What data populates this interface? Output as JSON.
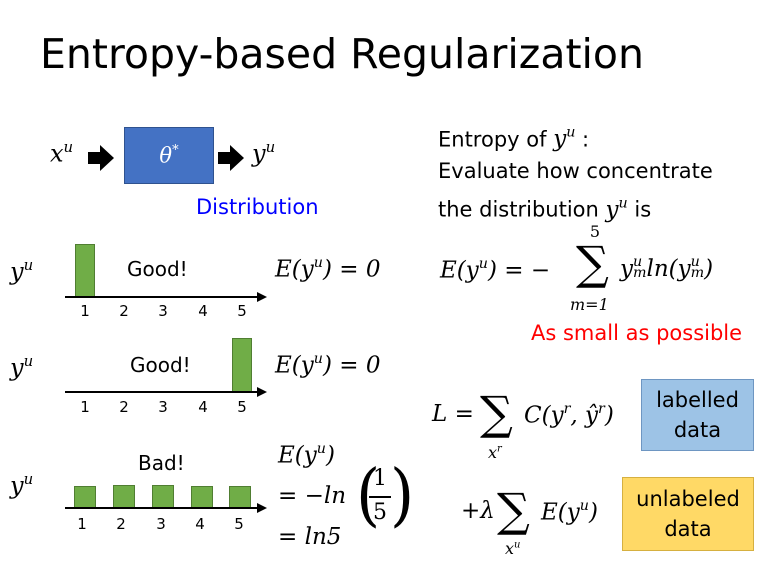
{
  "title": "Entropy-based Regularization",
  "model": {
    "input": "x",
    "input_sup": "u",
    "param": "θ",
    "param_sup": "*",
    "output": "y",
    "output_sup": "u",
    "distribution_label": "Distribution",
    "box_color": "#4472c4"
  },
  "entropy_text": {
    "line1_prefix": "Entropy of ",
    "line1_var": "y",
    "line1_sup": "u",
    "line1_suffix": " :",
    "line2": "Evaluate how concentrate",
    "line3_prefix": "the distribution ",
    "line3_var": "y",
    "line3_sup": "u",
    "line3_suffix": " is"
  },
  "examples": [
    {
      "ylabel": "y",
      "ylabel_sup": "u",
      "verdict": "Good!",
      "values": [
        1,
        0,
        0,
        0,
        0
      ],
      "formula": "E(y",
      "formula_sup": "u",
      "formula_end": ") = 0"
    },
    {
      "ylabel": "y",
      "ylabel_sup": "u",
      "verdict": "Good!",
      "values": [
        0,
        0,
        0,
        0,
        1
      ],
      "formula": "E(y",
      "formula_sup": "u",
      "formula_end": ") = 0"
    },
    {
      "ylabel": "y",
      "ylabel_sup": "u",
      "verdict": "Bad!",
      "values": [
        0.2,
        0.2,
        0.2,
        0.2,
        0.2
      ],
      "formula_lines": [
        "E(y",
        "= −ln",
        "= ln5"
      ],
      "formula_sup": "u",
      "formula_end": ")",
      "frac_num": "1",
      "frac_den": "5"
    }
  ],
  "tick_labels": [
    "1",
    "2",
    "3",
    "4",
    "5"
  ],
  "entropy_formula": {
    "lhs": "E(y",
    "lhs_sup": "u",
    "lhs_end": ") = −",
    "sum_top": "5",
    "sum_bottom": "m=1",
    "term": "y",
    "term_sup": "u",
    "term_sub": "m",
    "ln": "ln(y",
    "ln_sup": "u",
    "ln_sub": "m",
    "ln_end": ")",
    "note": "As small as possible",
    "note_color": "#ff0000"
  },
  "loss": {
    "lhs": "L =",
    "sum1_bottom": "x",
    "sum1_bottom_sup": "r",
    "term1": "C(y",
    "term1_sup": "r",
    "term1_mid": ", ŷ",
    "term1_sup2": "r",
    "term1_end": ")",
    "label1": [
      "labelled",
      "data"
    ],
    "label1_color": "#9dc3e6",
    "plus": "+λ",
    "sum2_bottom": "x",
    "sum2_bottom_sup": "u",
    "term2": "E(y",
    "term2_sup": "u",
    "term2_end": ")",
    "label2": [
      "unlabeled",
      "data"
    ],
    "label2_color": "#ffd966"
  }
}
